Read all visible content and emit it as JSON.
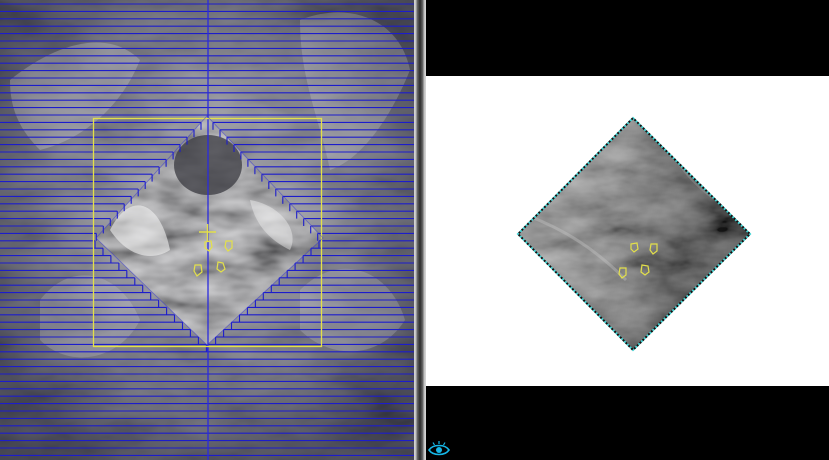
{
  "window": {
    "panes": [
      "beams-eye-view",
      "portal-image-view"
    ]
  },
  "beams_eye_view": {
    "leaf_color": "#1c1ccc",
    "field_outline_color": "#e3e04a",
    "aperture_shape": "diamond",
    "isocenter_marker": "crosshair",
    "fiducial_marker_count": 4
  },
  "portal_image_view": {
    "background_color": "#ffffff",
    "aperture_outline_color": "#3fd3d3",
    "fiducial_marker_count": 4
  },
  "icons": {
    "view_toggle": "eye-icon",
    "view_toggle_color": "#16b6e6"
  }
}
